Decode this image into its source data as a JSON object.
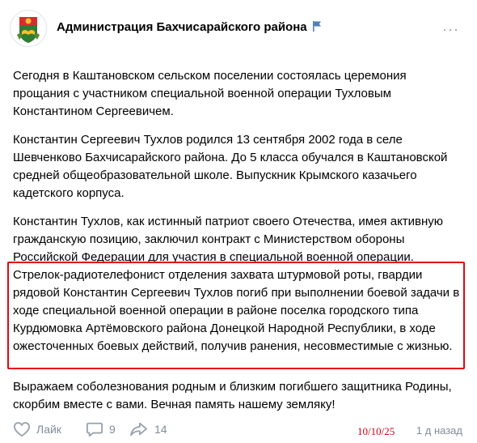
{
  "header": {
    "title": "Администрация Бахчисарайского района",
    "more_label": "···"
  },
  "post": {
    "paragraphs": [
      "Сегодня в Каштановском сельском поселении состоялась церемония прощания с участником специальной военной операции Тухловым Константином Сергеевичем.",
      "Константин Сергеевич Тухлов родился 13 сентября 2002 года в селе Шевченково Бахчисарайского района. До 5 класса обучался в Каштановской средней общеобразовательной школе. Выпускник Крымского казачьего кадетского корпуса.",
      "Константин Тухлов, как истинный патриот своего Отечества, имея активную гражданскую позицию, заключил контракт с Министерством обороны Российской Федерации для участия в специальной военной операции."
    ],
    "highlighted": "Стрелок-радиотелефонист отделения захвата штурмовой роты, гвардии рядовой Константин Сергеевич Тухлов погиб при выполнении боевой задачи в ходе специальной военной операции в районе поселка городского типа Курдюмовка Артёмовского района Донецкой Народной Республики, в ходе ожесточенных боевых действий, получив ранения, несовместимые с жизнью.",
    "closing": "Выражаем соболезнования родным и близким погибшего защитника Родины, скорбим вместе с вами. Вечная память нашему земляку!"
  },
  "footer": {
    "like_label": "Лайк",
    "comments_count": "9",
    "shares_count": "14",
    "stamp_date": "10/10/25",
    "time_ago": "1 д назад"
  },
  "colors": {
    "highlight_border": "#e30613",
    "meta_gray": "#818c99",
    "flag_blue": "#5181b8",
    "stamp_red": "#d0021b"
  },
  "icons": [
    "coat-of-arms-icon",
    "flag-icon",
    "heart-icon",
    "comment-icon",
    "share-icon"
  ]
}
